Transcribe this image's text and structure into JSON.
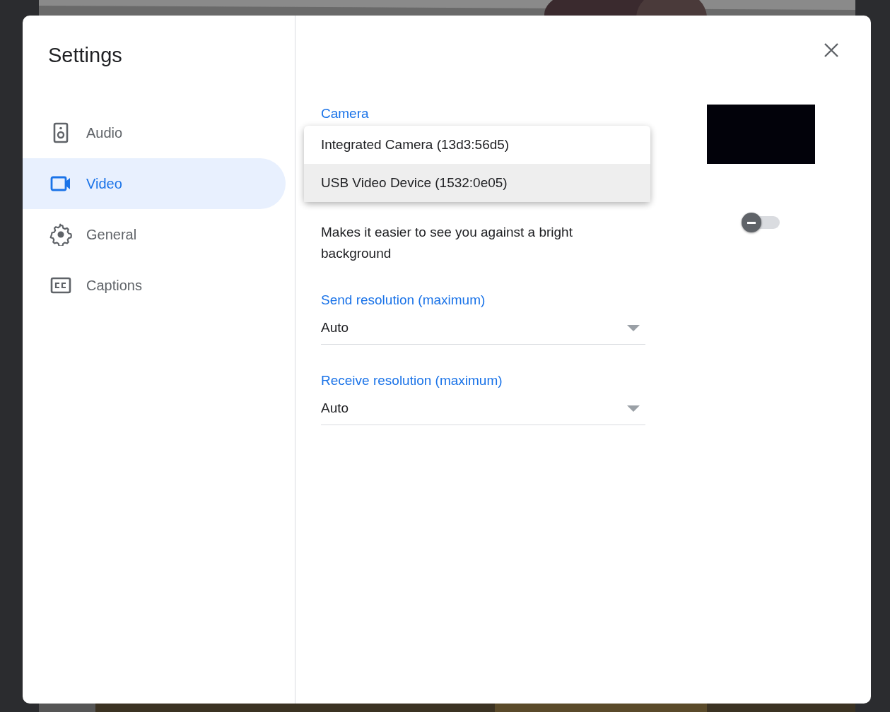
{
  "dialog": {
    "title": "Settings"
  },
  "sidebar": {
    "items": [
      {
        "label": "Audio",
        "kind": "speaker",
        "selected": false
      },
      {
        "label": "Video",
        "kind": "camera",
        "selected": true
      },
      {
        "label": "General",
        "kind": "gear",
        "selected": false
      },
      {
        "label": "Captions",
        "kind": "cc",
        "selected": false
      }
    ]
  },
  "video": {
    "camera": {
      "label": "Camera",
      "menu": [
        {
          "label": "Integrated Camera (13d3:56d5)",
          "selected": false
        },
        {
          "label": "USB Video Device (1532:0e05)",
          "selected": true
        }
      ]
    },
    "lighting": {
      "description": "Makes it easier to see you against a bright background",
      "on": false
    },
    "selects": [
      {
        "label": "Send resolution (maximum)",
        "value": "Auto"
      },
      {
        "label": "Receive resolution (maximum)",
        "value": "Auto"
      }
    ]
  }
}
